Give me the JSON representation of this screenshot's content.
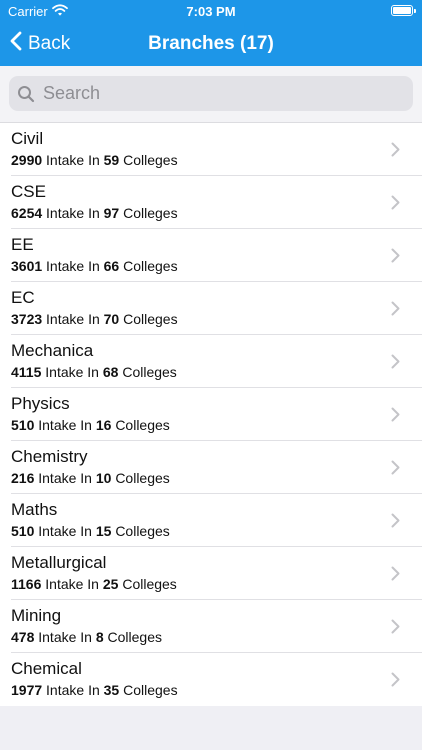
{
  "status": {
    "carrier": "Carrier",
    "time": "7:03 PM"
  },
  "nav": {
    "back_label": "Back",
    "title": "Branches (17)"
  },
  "search": {
    "placeholder": "Search",
    "value": ""
  },
  "labels": {
    "intake_in": "Intake In",
    "colleges": "Colleges"
  },
  "branches": [
    {
      "name": "Civil",
      "intake": "2990",
      "colleges": "59"
    },
    {
      "name": "CSE",
      "intake": "6254",
      "colleges": "97"
    },
    {
      "name": "EE",
      "intake": "3601",
      "colleges": "66"
    },
    {
      "name": "EC",
      "intake": "3723",
      "colleges": "70"
    },
    {
      "name": "Mechanica",
      "intake": "4115",
      "colleges": "68"
    },
    {
      "name": "Physics",
      "intake": "510",
      "colleges": "16"
    },
    {
      "name": "Chemistry",
      "intake": "216",
      "colleges": "10"
    },
    {
      "name": "Maths",
      "intake": "510",
      "colleges": "15"
    },
    {
      "name": "Metallurgical",
      "intake": "1166",
      "colleges": "25"
    },
    {
      "name": "Mining",
      "intake": "478",
      "colleges": "8"
    },
    {
      "name": "Chemical",
      "intake": "1977",
      "colleges": "35"
    }
  ],
  "colors": {
    "nav_bar": "#1d96e8",
    "background": "#efeff4",
    "chevron": "#c4c4c8"
  },
  "icons": {
    "back": "chevron-left-icon",
    "search": "search-icon",
    "row": "chevron-right-icon",
    "wifi": "wifi-icon",
    "battery": "battery-icon"
  }
}
